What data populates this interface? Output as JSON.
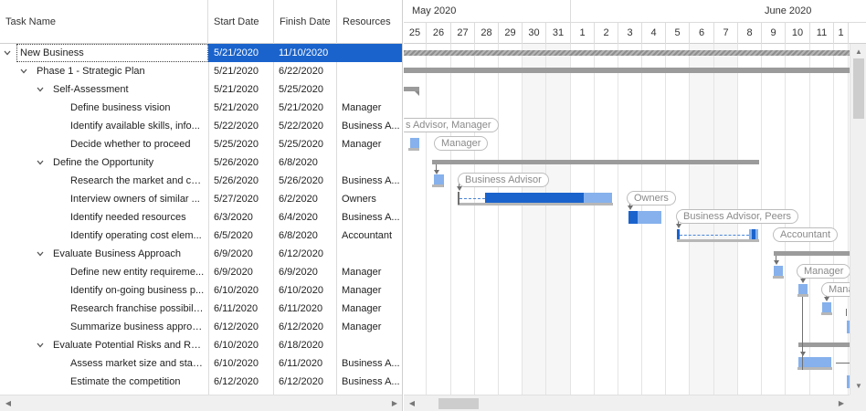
{
  "columns": {
    "task_name": "Task Name",
    "start_date": "Start Date",
    "finish_date": "Finish Date",
    "resources": "Resources"
  },
  "tasks": [
    {
      "name": "New Business",
      "start": "5/21/2020",
      "finish": "11/10/2020",
      "resources": "",
      "level": 0,
      "expandable": true,
      "selected": true
    },
    {
      "name": "Phase 1 - Strategic Plan",
      "start": "5/21/2020",
      "finish": "6/22/2020",
      "resources": "",
      "level": 1,
      "expandable": true
    },
    {
      "name": "Self-Assessment",
      "start": "5/21/2020",
      "finish": "5/25/2020",
      "resources": "",
      "level": 2,
      "expandable": true
    },
    {
      "name": "Define business vision",
      "start": "5/21/2020",
      "finish": "5/21/2020",
      "resources": "Manager",
      "level": 3
    },
    {
      "name": "Identify available skills, info...",
      "start": "5/22/2020",
      "finish": "5/22/2020",
      "resources": "Business A...",
      "level": 3
    },
    {
      "name": "Decide whether to proceed",
      "start": "5/25/2020",
      "finish": "5/25/2020",
      "resources": "Manager",
      "level": 3
    },
    {
      "name": "Define the Opportunity",
      "start": "5/26/2020",
      "finish": "6/8/2020",
      "resources": "",
      "level": 2,
      "expandable": true
    },
    {
      "name": "Research the market and co...",
      "start": "5/26/2020",
      "finish": "5/26/2020",
      "resources": "Business A...",
      "level": 3
    },
    {
      "name": "Interview owners of similar ...",
      "start": "5/27/2020",
      "finish": "6/2/2020",
      "resources": "Owners",
      "level": 3
    },
    {
      "name": "Identify needed resources",
      "start": "6/3/2020",
      "finish": "6/4/2020",
      "resources": "Business A...",
      "level": 3
    },
    {
      "name": "Identify operating cost elem...",
      "start": "6/5/2020",
      "finish": "6/8/2020",
      "resources": "Accountant",
      "level": 3
    },
    {
      "name": "Evaluate Business Approach",
      "start": "6/9/2020",
      "finish": "6/12/2020",
      "resources": "",
      "level": 2,
      "expandable": true
    },
    {
      "name": "Define new entity requireme...",
      "start": "6/9/2020",
      "finish": "6/9/2020",
      "resources": "Manager",
      "level": 3
    },
    {
      "name": "Identify on-going business p...",
      "start": "6/10/2020",
      "finish": "6/10/2020",
      "resources": "Manager",
      "level": 3
    },
    {
      "name": "Research franchise possibilit...",
      "start": "6/11/2020",
      "finish": "6/11/2020",
      "resources": "Manager",
      "level": 3
    },
    {
      "name": "Summarize business approach",
      "start": "6/12/2020",
      "finish": "6/12/2020",
      "resources": "Manager",
      "level": 3
    },
    {
      "name": "Evaluate Potential Risks and Re...",
      "start": "6/10/2020",
      "finish": "6/18/2020",
      "resources": "",
      "level": 2,
      "expandable": true
    },
    {
      "name": "Assess market size and stab...",
      "start": "6/10/2020",
      "finish": "6/11/2020",
      "resources": "Business A...",
      "level": 3
    },
    {
      "name": "Estimate the competition",
      "start": "6/12/2020",
      "finish": "6/12/2020",
      "resources": "Business A...",
      "level": 3
    }
  ],
  "timescale": {
    "months": [
      {
        "label": "May 2020",
        "first_day_index": 0
      },
      {
        "label": "June 2020",
        "first_day_index": 7
      }
    ],
    "days": [
      "25",
      "26",
      "27",
      "28",
      "29",
      "30",
      "31",
      "1",
      "2",
      "3",
      "4",
      "5",
      "6",
      "7",
      "8",
      "9",
      "10",
      "11",
      "1"
    ],
    "weekend_day_indices": [
      5,
      6,
      12,
      13
    ]
  },
  "resource_labels": [
    {
      "row": 4,
      "text": "s Advisor, Manager"
    },
    {
      "row": 5,
      "text": "Manager"
    },
    {
      "row": 7,
      "text": "Business Advisor"
    },
    {
      "row": 8,
      "text": "Owners"
    },
    {
      "row": 9,
      "text": "Business Advisor, Peers"
    },
    {
      "row": 10,
      "text": "Accountant"
    },
    {
      "row": 12,
      "text": "Manager"
    },
    {
      "row": 13,
      "text": "Mana"
    }
  ],
  "icons": {
    "expand": "chevron-down-icon",
    "scroll_left": "arrow-left-icon",
    "scroll_right": "arrow-right-icon",
    "scroll_up": "arrow-up-icon",
    "scroll_down": "arrow-down-icon"
  },
  "colors": {
    "selection": "#1a63cc",
    "task_bar": "#86b1ec",
    "task_progress": "#1a63cc",
    "summary_bar": "#9b9b9b"
  }
}
